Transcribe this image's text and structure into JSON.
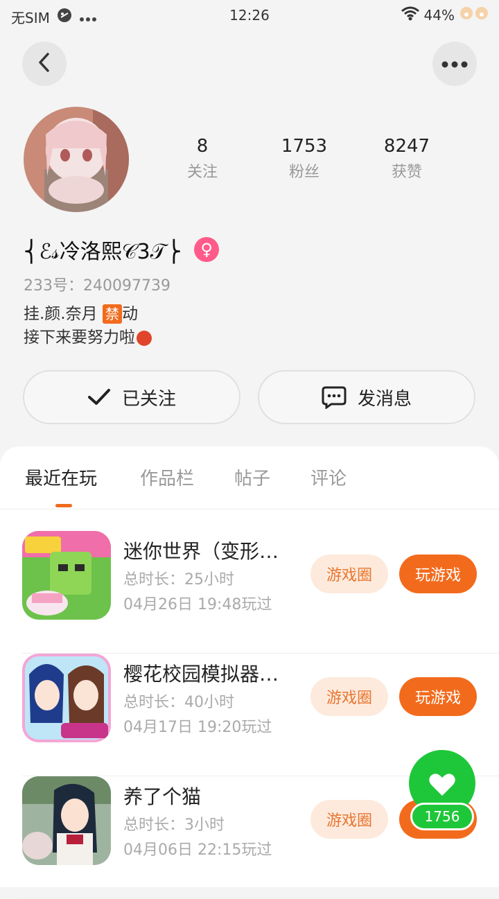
{
  "status_bar": {
    "carrier": "无SIM",
    "time": "12:26",
    "battery": "44%",
    "icons": [
      "dnd-icon",
      "more-dots-icon",
      "wifi-icon",
      "paw-icon"
    ]
  },
  "header": {
    "back_icon": "chevron-left-icon",
    "more_icon": "more-horizontal-icon"
  },
  "profile": {
    "stats": [
      {
        "value": "8",
        "label": "关注"
      },
      {
        "value": "1753",
        "label": "粉丝"
      },
      {
        "value": "8247",
        "label": "获赞"
      }
    ],
    "nickname": "⎨ℰ𝓈冷洛熙𝒞3𝒯⎬",
    "gender_symbol": "♀",
    "uid": "233号：240097739",
    "bio_line1_prefix": "挂.颜.奈月 ",
    "bio_badge": "禁",
    "bio_line1_suffix": "动",
    "bio_line2": "接下来要努力啦"
  },
  "actions": {
    "follow_label": "已关注",
    "message_label": "发消息"
  },
  "tabs": [
    {
      "label": "最近在玩",
      "active": true
    },
    {
      "label": "作品栏",
      "active": false
    },
    {
      "label": "帖子",
      "active": false
    },
    {
      "label": "评论",
      "active": false
    }
  ],
  "games": [
    {
      "name": "迷你世界（变形…",
      "duration": "总时长：25小时",
      "last_played": "04月26日  19:48玩过",
      "circle_label": "游戏圈",
      "play_label": "玩游戏"
    },
    {
      "name": "樱花校园模拟器…",
      "duration": "总时长：40小时",
      "last_played": "04月17日  19:20玩过",
      "circle_label": "游戏圈",
      "play_label": "玩游戏"
    },
    {
      "name": "养了个猫",
      "duration": "总时长：3小时",
      "last_played": "04月06日  22:15玩过",
      "circle_label": "游戏圈",
      "play_label": "玩游戏"
    }
  ],
  "like_fab": {
    "count": "1756",
    "icon": "heart-icon"
  },
  "colors": {
    "accent": "#f26b1d",
    "accent_light": "#fdeadd",
    "like_green": "#1ec739",
    "gender_pink": "#ff5a8a"
  }
}
